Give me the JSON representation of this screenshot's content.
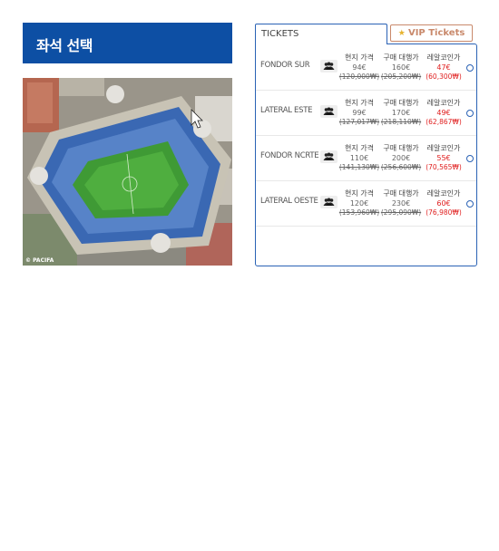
{
  "page": {
    "title": "좌석 선택",
    "watermark": "© PACIFA"
  },
  "tabs": {
    "tickets_label": "TICKETS",
    "vip_label": "VIP Tickets"
  },
  "columns": {
    "local_price": "현지 가격",
    "agency_price": "구매 대행가",
    "realcoin_price": "레알코인가"
  },
  "tickets": [
    {
      "name": "FONDOR SUR",
      "local_price": "94€",
      "local_krw": "(120,000₩)",
      "agency_price": "160€",
      "agency_krw": "(205,200₩)",
      "realcoin_price": "47€",
      "realcoin_krw": "(60,300₩)"
    },
    {
      "name": "LATERAL ESTE",
      "local_price": "99€",
      "local_krw": "(127,017₩)",
      "agency_price": "170€",
      "agency_krw": "(218,110₩)",
      "realcoin_price": "49€",
      "realcoin_krw": "(62,867₩)"
    },
    {
      "name": "FONDOR NCRTE",
      "local_price": "110€",
      "local_krw": "(141,130₩)",
      "agency_price": "200€",
      "agency_krw": "(256,600₩)",
      "realcoin_price": "55€",
      "realcoin_krw": "(70,565₩)"
    },
    {
      "name": "LATERAL OESTE",
      "local_price": "120€",
      "local_krw": "(153,960₩)",
      "agency_price": "230€",
      "agency_krw": "(295,090₩)",
      "realcoin_price": "60€",
      "realcoin_krw": "(76,980₩)"
    }
  ],
  "colors": {
    "header_blue": "#0d4fa4",
    "panel_border": "#2a62b5",
    "realcoin_red": "#e02020",
    "vip_accent": "#c9896b"
  },
  "icons": {
    "seat": "seat-group-icon",
    "star": "star-icon",
    "radio": "radio-button"
  }
}
